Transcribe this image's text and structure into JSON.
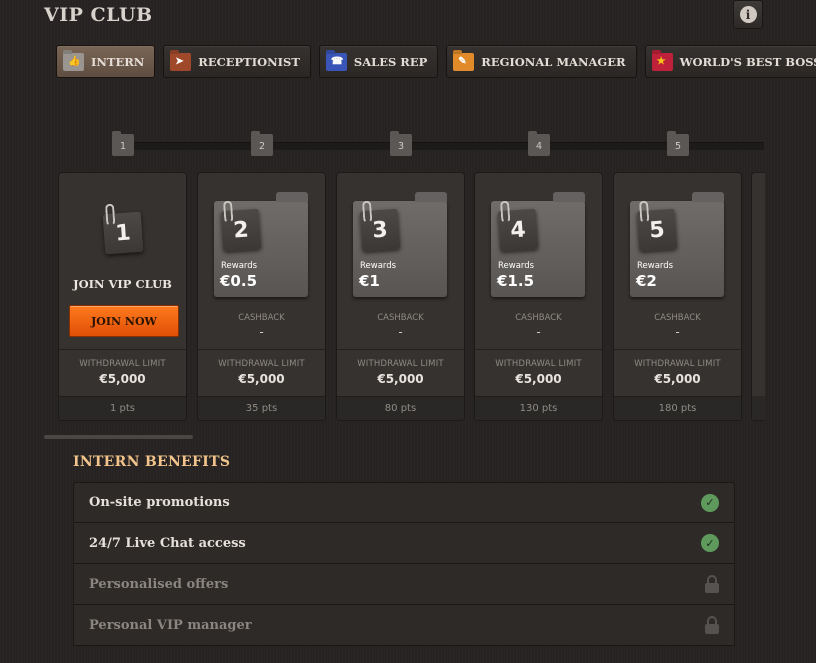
{
  "page": {
    "title": "VIP CLUB"
  },
  "tabs": [
    {
      "label": "INTERN",
      "icon": "thumb-icon",
      "color": "#9a9590",
      "active": true
    },
    {
      "label": "RECEPTIONIST",
      "icon": "cursor-icon",
      "color": "#a0482a",
      "active": false
    },
    {
      "label": "SALES REP",
      "icon": "phone-icon",
      "color": "#3a55b8",
      "active": false
    },
    {
      "label": "REGIONAL MANAGER",
      "icon": "badge-icon",
      "color": "#e08a2a",
      "active": false
    },
    {
      "label": "WORLD'S BEST BOSS",
      "icon": "star-icon",
      "color": "#c0213a",
      "active": false
    }
  ],
  "steps": [
    "1",
    "2",
    "3",
    "4",
    "5"
  ],
  "levels": [
    {
      "number": "1",
      "join_title": "JOIN VIP CLUB",
      "join_button": "JOIN NOW",
      "withdrawal_label": "WITHDRAWAL LIMIT",
      "withdrawal_value": "€5,000",
      "points": "1 pts"
    },
    {
      "number": "2",
      "rewards_label": "Rewards",
      "rewards_value": "€0.5",
      "cashback_label": "CASHBACK",
      "cashback_value": "-",
      "withdrawal_label": "WITHDRAWAL LIMIT",
      "withdrawal_value": "€5,000",
      "points": "35 pts"
    },
    {
      "number": "3",
      "rewards_label": "Rewards",
      "rewards_value": "€1",
      "cashback_label": "CASHBACK",
      "cashback_value": "-",
      "withdrawal_label": "WITHDRAWAL LIMIT",
      "withdrawal_value": "€5,000",
      "points": "80 pts"
    },
    {
      "number": "4",
      "rewards_label": "Rewards",
      "rewards_value": "€1.5",
      "cashback_label": "CASHBACK",
      "cashback_value": "-",
      "withdrawal_label": "WITHDRAWAL LIMIT",
      "withdrawal_value": "€5,000",
      "points": "130 pts"
    },
    {
      "number": "5",
      "rewards_label": "Rewards",
      "rewards_value": "€2",
      "cashback_label": "CASHBACK",
      "cashback_value": "-",
      "withdrawal_label": "WITHDRAWAL LIMIT",
      "withdrawal_value": "€5,000",
      "points": "180 pts"
    }
  ],
  "benefits": {
    "title": "INTERN BENEFITS",
    "items": [
      {
        "label": "On-site promotions",
        "status": "included"
      },
      {
        "label": "24/7 Live Chat access",
        "status": "included"
      },
      {
        "label": "Personalised offers",
        "status": "locked"
      },
      {
        "label": "Personal VIP manager",
        "status": "locked"
      }
    ]
  },
  "colors": {
    "accent": "#f2c48c",
    "join_button": "#f06414",
    "check": "#5f9a5d"
  }
}
